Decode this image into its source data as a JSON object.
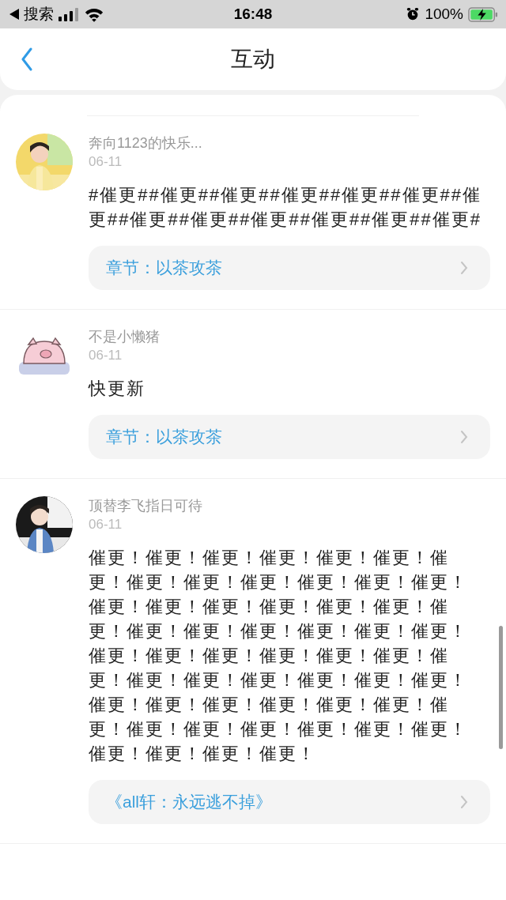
{
  "status_bar": {
    "back_label": "搜索",
    "time": "16:48",
    "battery": "100%"
  },
  "header": {
    "title": "互动"
  },
  "comments": [
    {
      "name": "奔向1123的快乐...",
      "date": "06-11",
      "text": "#催更##催更##催更##催更##催更##催更##催更##催更##催更##催更##催更##催更##催更#",
      "chapter": "章节：以茶攻茶"
    },
    {
      "avatar": {
        "kind": "pig"
      },
      "name": "不是小懒猪",
      "date": "06-11",
      "text": "快更新",
      "chapter": "章节：以茶攻茶"
    },
    {
      "name": "顶替李飞指日可待",
      "date": "06-11",
      "text": "催更！催更！催更！催更！催更！催更！催更！催更！催更！催更！催更！催更！催更！催更！催更！催更！催更！催更！催更！催更！催更！催更！催更！催更！催更！催更！催更！催更！催更！催更！催更！催更！催更！催更！催更！催更！催更！催更！催更！催更！催更！催更！催更！催更！催更！催更！催更！催更！催更！催更！催更！催更！催更！催更！催更！催更！",
      "chapter": "《all轩：永远逃不掉》"
    }
  ]
}
